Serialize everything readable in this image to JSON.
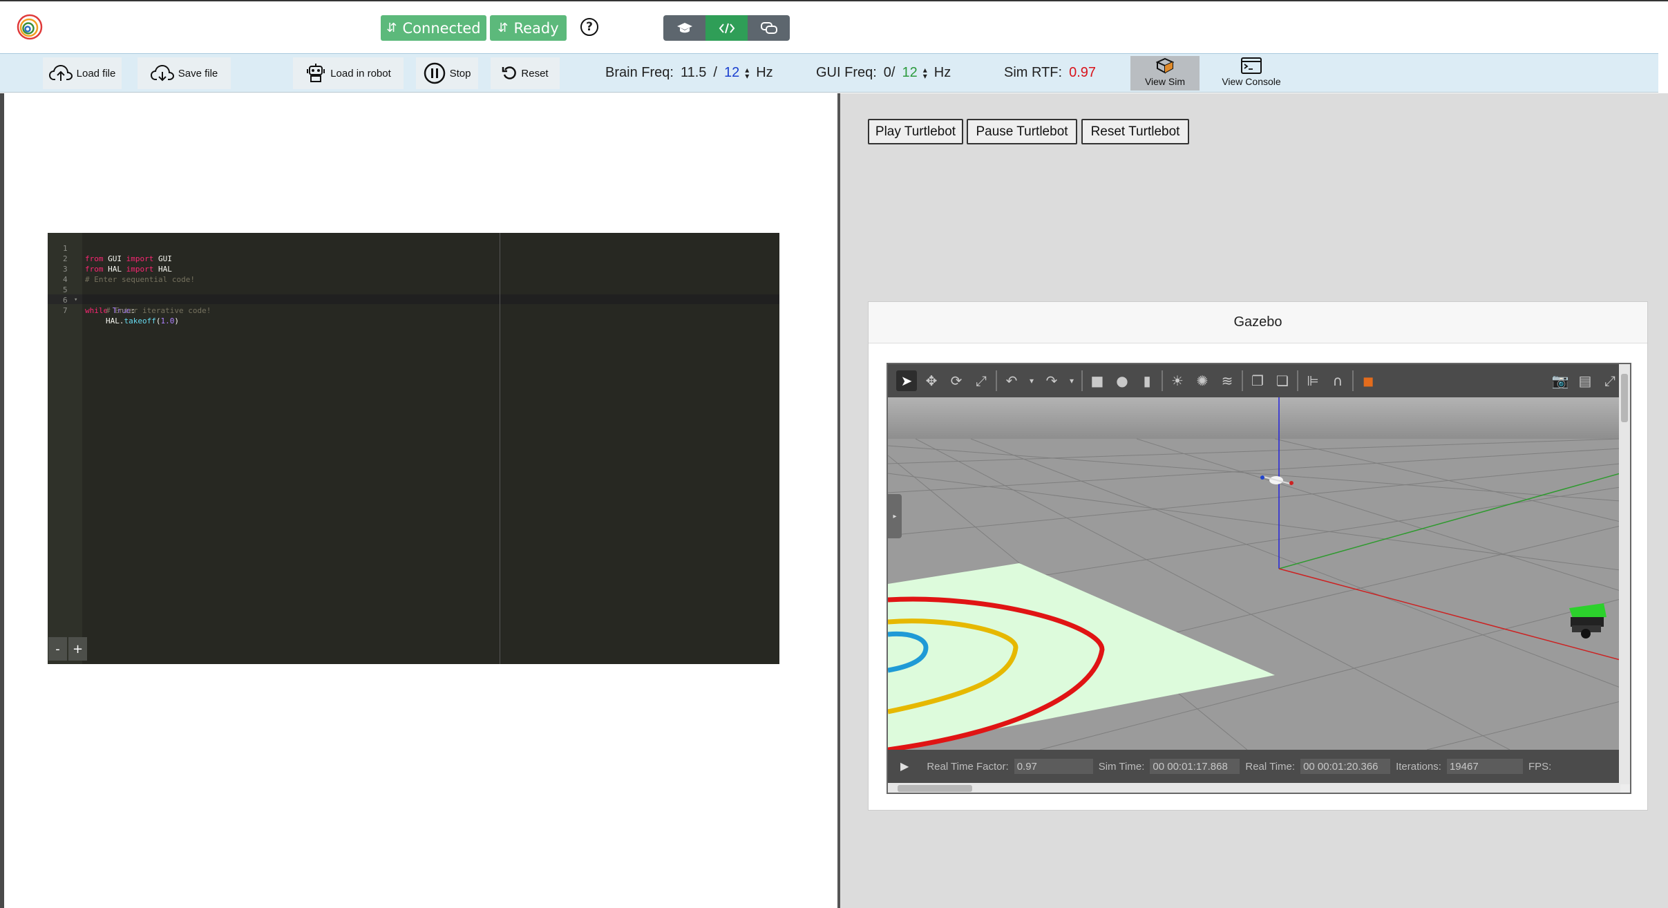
{
  "header": {
    "logo_icon": "spiral-logo-icon",
    "connected_label": "Connected",
    "ready_label": "Ready",
    "help_glyph": "?",
    "view_modes": [
      "exercise-icon",
      "code-icon",
      "forum-icon"
    ],
    "accent_green": "#5cb97b"
  },
  "toolbar": {
    "load_file": "Load file",
    "save_file": "Save file",
    "load_robot": "Load in robot",
    "stop": "Stop",
    "reset": "Reset",
    "brain_freq_label": "Brain Freq:",
    "brain_freq_value": "11.5",
    "brain_freq_sep": "/",
    "brain_freq_target": "12",
    "brain_freq_unit": "Hz",
    "gui_freq_label": "GUI Freq:",
    "gui_freq_value": "0/",
    "gui_freq_target": "12",
    "gui_freq_unit": "Hz",
    "sim_rtf_label": "Sim RTF:",
    "sim_rtf_value": "0.97",
    "view_sim": "View Sim",
    "view_console": "View Console"
  },
  "editor": {
    "line_numbers": [
      "1",
      "2",
      "3",
      "4",
      "5",
      "6",
      "7"
    ],
    "zoom_out": "-",
    "zoom_in": "+",
    "tokens": {
      "from": "from",
      "import": "import",
      "gui": "GUI",
      "hal": "HAL",
      "comment_seq": "# Enter sequential code!",
      "while": "while",
      "true": "True",
      "colon": ":",
      "comment_iter": "# Enter iterative code!",
      "hal_obj": "HAL.",
      "takeoff": "takeoff",
      "lparen": "(",
      "arg": "1.0",
      "rparen": ")"
    }
  },
  "right": {
    "play": "Play Turtlebot",
    "pause": "Pause Turtlebot",
    "reset": "Reset Turtlebot",
    "gazebo_title": "Gazebo",
    "gazebo_status": {
      "rtf_label": "Real Time Factor:",
      "rtf_value": "0.97",
      "sim_time_label": "Sim Time:",
      "sim_time_value": "00 00:01:17.868",
      "real_time_label": "Real Time:",
      "real_time_value": "00 00:01:20.366",
      "iterations_label": "Iterations:",
      "iterations_value": "19467",
      "fps_label": "FPS:"
    }
  }
}
